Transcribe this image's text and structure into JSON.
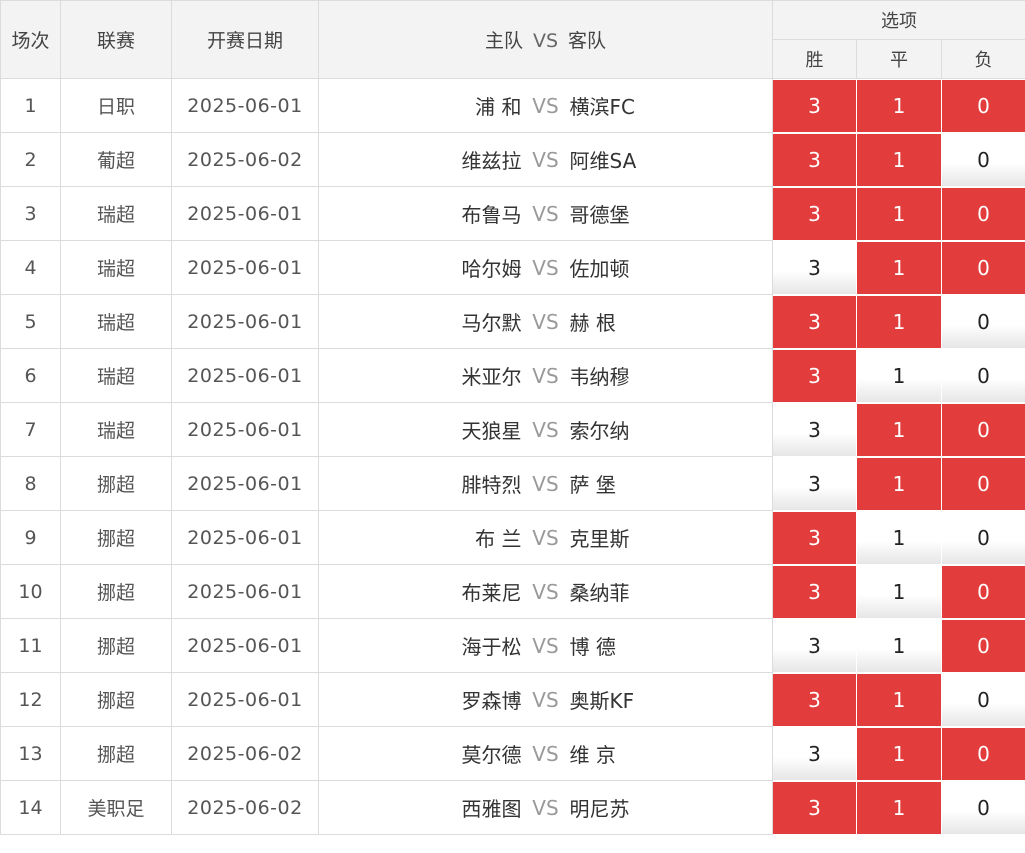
{
  "header": {
    "col_index": "场次",
    "col_league": "联赛",
    "col_date": "开赛日期",
    "col_home": "主队",
    "col_vs": "VS",
    "col_away": "客队",
    "options_group": "选项",
    "opt_win": "胜",
    "opt_draw": "平",
    "opt_lose": "负"
  },
  "colors": {
    "selected": "#e23c3c",
    "border": "#dcdcdc",
    "header_bg": "#f3f3f3"
  },
  "rows": [
    {
      "no": "1",
      "league": "日职",
      "date": "2025-06-01",
      "home": "浦 和",
      "vs": "VS",
      "away": "横滨FC",
      "win": "3",
      "draw": "1",
      "lose": "0",
      "win_sel": true,
      "draw_sel": true,
      "lose_sel": true
    },
    {
      "no": "2",
      "league": "葡超",
      "date": "2025-06-02",
      "home": "维兹拉",
      "vs": "VS",
      "away": "阿维SA",
      "win": "3",
      "draw": "1",
      "lose": "0",
      "win_sel": true,
      "draw_sel": true,
      "lose_sel": false
    },
    {
      "no": "3",
      "league": "瑞超",
      "date": "2025-06-01",
      "home": "布鲁马",
      "vs": "VS",
      "away": "哥德堡",
      "win": "3",
      "draw": "1",
      "lose": "0",
      "win_sel": true,
      "draw_sel": true,
      "lose_sel": true
    },
    {
      "no": "4",
      "league": "瑞超",
      "date": "2025-06-01",
      "home": "哈尔姆",
      "vs": "VS",
      "away": "佐加顿",
      "win": "3",
      "draw": "1",
      "lose": "0",
      "win_sel": false,
      "draw_sel": true,
      "lose_sel": true
    },
    {
      "no": "5",
      "league": "瑞超",
      "date": "2025-06-01",
      "home": "马尔默",
      "vs": "VS",
      "away": "赫 根",
      "win": "3",
      "draw": "1",
      "lose": "0",
      "win_sel": true,
      "draw_sel": true,
      "lose_sel": false
    },
    {
      "no": "6",
      "league": "瑞超",
      "date": "2025-06-01",
      "home": "米亚尔",
      "vs": "VS",
      "away": "韦纳穆",
      "win": "3",
      "draw": "1",
      "lose": "0",
      "win_sel": true,
      "draw_sel": false,
      "lose_sel": false
    },
    {
      "no": "7",
      "league": "瑞超",
      "date": "2025-06-01",
      "home": "天狼星",
      "vs": "VS",
      "away": "索尔纳",
      "win": "3",
      "draw": "1",
      "lose": "0",
      "win_sel": false,
      "draw_sel": true,
      "lose_sel": true
    },
    {
      "no": "8",
      "league": "挪超",
      "date": "2025-06-01",
      "home": "腓特烈",
      "vs": "VS",
      "away": "萨 堡",
      "win": "3",
      "draw": "1",
      "lose": "0",
      "win_sel": false,
      "draw_sel": true,
      "lose_sel": true
    },
    {
      "no": "9",
      "league": "挪超",
      "date": "2025-06-01",
      "home": "布 兰",
      "vs": "VS",
      "away": "克里斯",
      "win": "3",
      "draw": "1",
      "lose": "0",
      "win_sel": true,
      "draw_sel": false,
      "lose_sel": false
    },
    {
      "no": "10",
      "league": "挪超",
      "date": "2025-06-01",
      "home": "布莱尼",
      "vs": "VS",
      "away": "桑纳菲",
      "win": "3",
      "draw": "1",
      "lose": "0",
      "win_sel": true,
      "draw_sel": false,
      "lose_sel": true
    },
    {
      "no": "11",
      "league": "挪超",
      "date": "2025-06-01",
      "home": "海于松",
      "vs": "VS",
      "away": "博 德",
      "win": "3",
      "draw": "1",
      "lose": "0",
      "win_sel": false,
      "draw_sel": false,
      "lose_sel": true
    },
    {
      "no": "12",
      "league": "挪超",
      "date": "2025-06-01",
      "home": "罗森博",
      "vs": "VS",
      "away": "奥斯KF",
      "win": "3",
      "draw": "1",
      "lose": "0",
      "win_sel": true,
      "draw_sel": true,
      "lose_sel": false
    },
    {
      "no": "13",
      "league": "挪超",
      "date": "2025-06-02",
      "home": "莫尔德",
      "vs": "VS",
      "away": "维 京",
      "win": "3",
      "draw": "1",
      "lose": "0",
      "win_sel": false,
      "draw_sel": true,
      "lose_sel": true
    },
    {
      "no": "14",
      "league": "美职足",
      "date": "2025-06-02",
      "home": "西雅图",
      "vs": "VS",
      "away": "明尼苏",
      "win": "3",
      "draw": "1",
      "lose": "0",
      "win_sel": true,
      "draw_sel": true,
      "lose_sel": false
    }
  ]
}
